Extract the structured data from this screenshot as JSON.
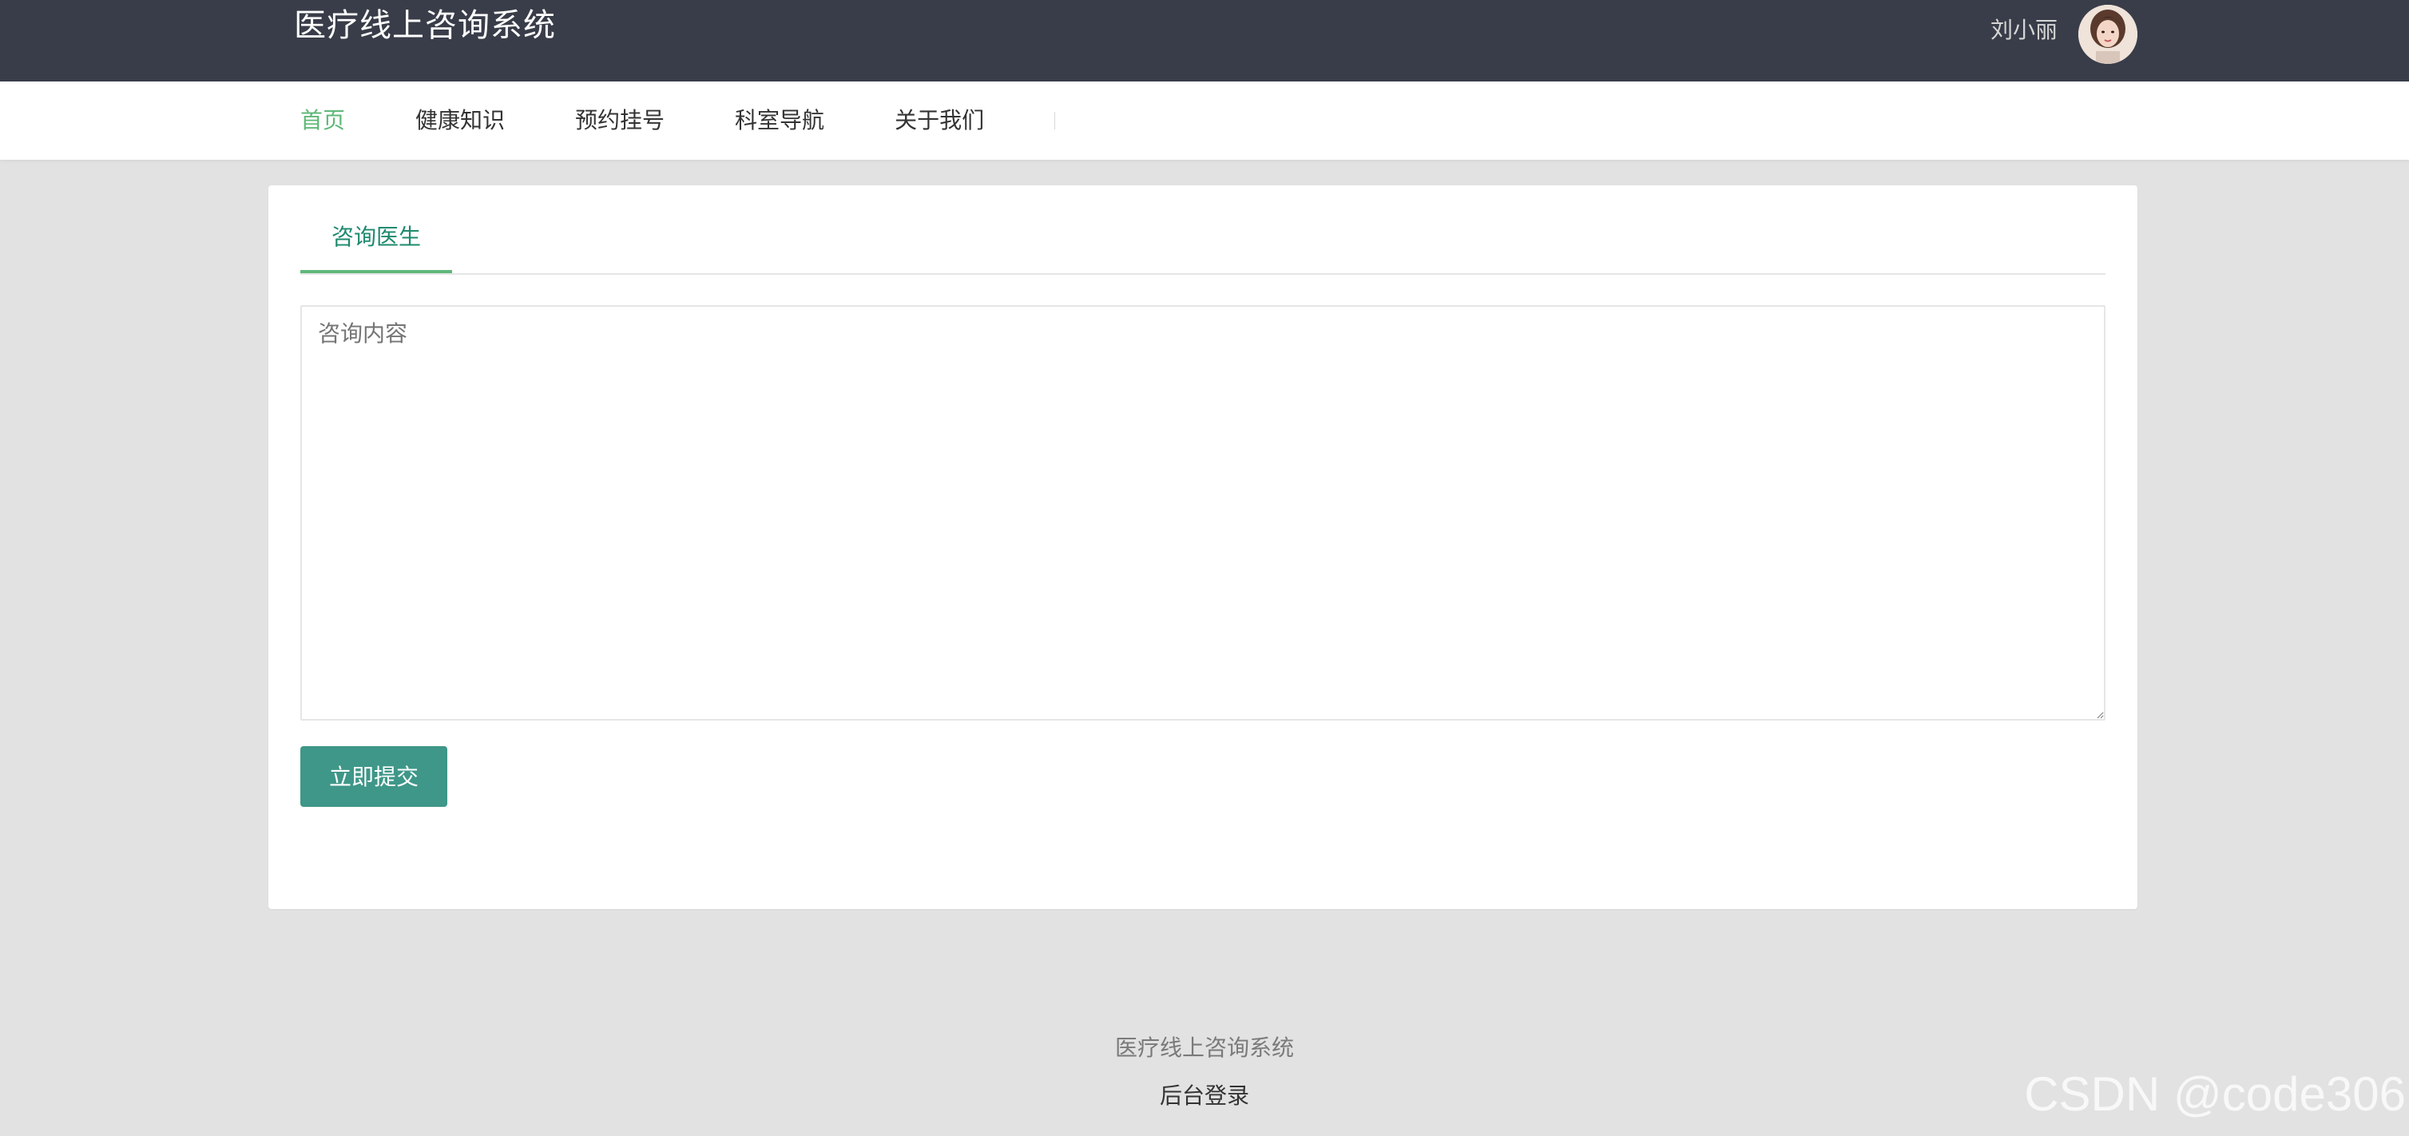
{
  "header": {
    "app_title": "医疗线上咨询系统",
    "user_name": "刘小丽",
    "avatar_icon": "user-avatar-photo"
  },
  "nav": {
    "items": [
      {
        "label": "首页",
        "active": true
      },
      {
        "label": "健康知识",
        "active": false
      },
      {
        "label": "预约挂号",
        "active": false
      },
      {
        "label": "科室导航",
        "active": false
      },
      {
        "label": "关于我们",
        "active": false
      }
    ]
  },
  "main": {
    "tabs": [
      {
        "label": "咨询医生",
        "active": true
      }
    ],
    "consult_input": {
      "value": "",
      "placeholder": "咨询内容"
    },
    "submit_label": "立即提交"
  },
  "footer": {
    "title": "医疗线上咨询系统",
    "admin_login": "后台登录"
  },
  "watermark": "CSDN @code306",
  "colors": {
    "header_bg": "#393d49",
    "accent_green": "#5fb878",
    "tab_text": "#1e8a6e",
    "button_bg": "#3e9788",
    "page_bg": "#e2e2e2"
  }
}
